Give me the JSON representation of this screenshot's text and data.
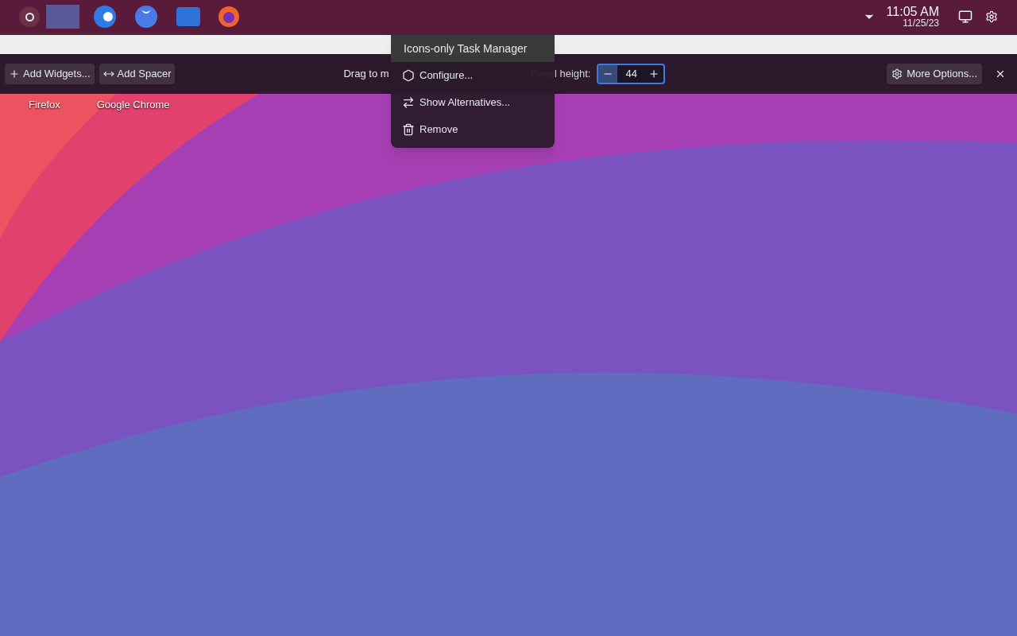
{
  "panel": {
    "time": "11:05 AM",
    "date": "11/25/23"
  },
  "edit_toolbar": {
    "add_widgets": "Add Widgets...",
    "add_spacer": "Add Spacer",
    "drag_hint": "Drag to m",
    "height_label": "Panel height:",
    "height_value": "44",
    "more_options": "More Options..."
  },
  "desktop_icons": [
    {
      "label": "Firefox"
    },
    {
      "label": "Google Chrome"
    }
  ],
  "context_menu": {
    "title": "Icons-only Task Manager",
    "items": [
      {
        "kind": "configure",
        "label": "Configure..."
      },
      {
        "kind": "alternatives",
        "label": "Show Alternatives..."
      },
      {
        "kind": "remove",
        "label": "Remove"
      }
    ]
  }
}
